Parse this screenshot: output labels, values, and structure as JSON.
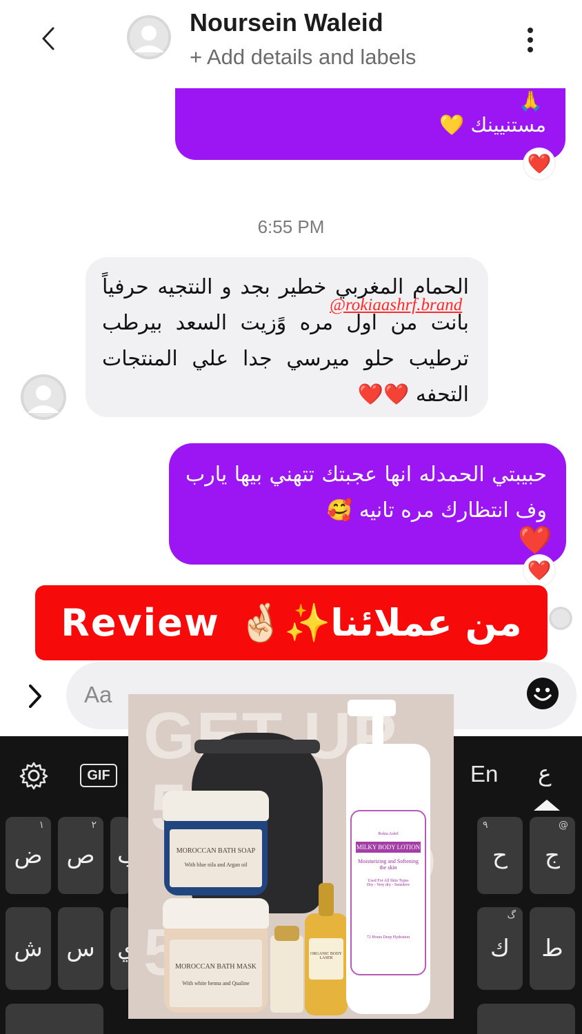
{
  "header": {
    "contact_name": "Noursein Waleid",
    "subtitle": "+ Add details and labels",
    "back_icon": "chevron-left-icon",
    "more_icon": "more-vertical-icon"
  },
  "messages": [
    {
      "direction": "outgoing",
      "text": "مستنيينك 💛",
      "emoji_top": "🙏",
      "reaction": "❤️"
    },
    {
      "direction": "incoming",
      "text": "الحمام المغربي خطير بجد و النتجيه حرفياً بانت من اول مره وًزيت السعد بيرطب ترطيب حلو ميرسي جدا علي المنتجات التحفه ❤️❤️"
    },
    {
      "direction": "outgoing",
      "text": "حبيبتي الحمدله انها عجبتك تتهني بيها يارب وف انتظارك مره تانيه 🥰",
      "inline_heart": "❤️",
      "reaction": "❤️"
    }
  ],
  "timestamp": "6:55 PM",
  "watermark": "@rokiaashrf.brand",
  "banner": {
    "arabic": "من عملائنا✨🤞🏻",
    "latin": "Review"
  },
  "composer": {
    "placeholder": "Aa",
    "expand_icon": "chevron-right-icon",
    "emoji_icon": "smiley-icon"
  },
  "keyboard": {
    "toolbar": {
      "settings_icon": "gear-icon",
      "gif_label": "GIF",
      "lang_en": "En",
      "lang_ar": "ع"
    },
    "row1": [
      {
        "char": "ض",
        "hint": "١"
      },
      {
        "char": "ص",
        "hint": "٢"
      },
      {
        "char": "ح",
        "hint": "٩"
      },
      {
        "char": "ج",
        "hint": "@"
      }
    ],
    "row2": [
      {
        "char": "ش",
        "hint": ""
      },
      {
        "char": "س",
        "hint": ""
      },
      {
        "char": "ك",
        "hint": "گ"
      },
      {
        "char": "ط",
        "hint": ""
      }
    ],
    "partial_left_row1": "ب",
    "partial_left_row2": "ي"
  },
  "product_photo": {
    "background_text": [
      "GET UP",
      "50",
      "O",
      "5"
    ],
    "soap_jar_label": "MOROCCAN BATH SOAP",
    "soap_jar_sub": "With blue nila and Argan oil",
    "mask_jar_label": "MOROCCAN BATH MASK",
    "mask_jar_sub": "With white henna and Qualine",
    "lotion_brand": "Rokia Ashrf",
    "lotion_title": "MILKY BODY LOTION",
    "lotion_sub": "Moisturizing and Softening the skin",
    "lotion_note": "Used For All Skin Types",
    "lotion_types": "Dry - Very dry - Sensitive",
    "lotion_hours": "72 Hours Deep Hydration",
    "body_lasir_label": "ORGANIC BODY LASER"
  }
}
